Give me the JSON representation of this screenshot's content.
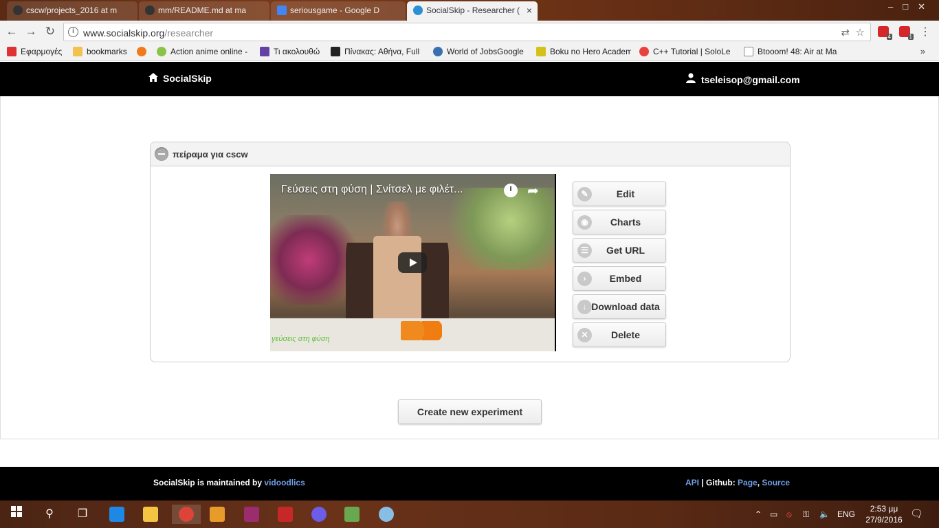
{
  "browser": {
    "tabs": [
      {
        "label": "cscw/projects_2016 at m",
        "icon_color": "#333333",
        "active": false
      },
      {
        "label": "mm/README.md at ma",
        "icon_color": "#333333",
        "active": false
      },
      {
        "label": "seriousgame - Google D",
        "icon_color": "#4285f4",
        "active": false
      },
      {
        "label": "SocialSkip - Researcher (",
        "icon_color": "#2b8fd6",
        "active": true
      }
    ],
    "close_glyph": "×",
    "url_domain": "www.socialskip.org",
    "url_path": "/researcher",
    "extension_badges": [
      "4",
      "1"
    ],
    "bookmarks": [
      {
        "label": "Εφαρμογές",
        "icon": "apps-icon",
        "color": "#d33"
      },
      {
        "label": "bookmarks",
        "icon": "folder-icon",
        "color": "#f2c14e"
      },
      {
        "label": "",
        "icon": "ubuntu-icon",
        "color": "#f07b1d"
      },
      {
        "label": "Action anime online -",
        "icon": "multicolor-icon",
        "color": "#8bc34a"
      },
      {
        "label": "Τι ακολουθώ",
        "icon": "twitch-icon",
        "color": "#6441a5"
      },
      {
        "label": "Πίνακας: Αθήνα, Full",
        "icon": "cat-icon",
        "color": "#222222"
      },
      {
        "label": "World of JobsGoogle",
        "icon": "c-icon",
        "color": "#3a6fb0"
      },
      {
        "label": "Boku no Hero Academ",
        "icon": "u-icon",
        "color": "#d4c21a"
      },
      {
        "label": "C++ Tutorial | SoloLe",
        "icon": "sololearn-icon",
        "color": "#e8423f"
      },
      {
        "label": "Btooom! 48: Air at Ma",
        "icon": "page-icon",
        "color": "#888888"
      }
    ],
    "bookmarks_more": "»"
  },
  "site": {
    "brand": "SocialSkip",
    "user_email": "tseleisop@gmail.com"
  },
  "experiment": {
    "title": "πείραμα για cscw",
    "video_title": "Γεύσεις στη φύση | Σνίτσελ με φιλέτ...",
    "video_watermark": "γεύσεις στη φύση",
    "actions": [
      {
        "label": "Edit",
        "icon": "pencil-icon",
        "glyph": "✎"
      },
      {
        "label": "Charts",
        "icon": "eye-icon",
        "glyph": "◉"
      },
      {
        "label": "Get URL",
        "icon": "list-icon",
        "glyph": "☰"
      },
      {
        "label": "Embed",
        "icon": "chevron-right-icon",
        "glyph": "›"
      },
      {
        "label": "Download data",
        "icon": "download-icon",
        "glyph": "↓"
      },
      {
        "label": "Delete",
        "icon": "close-icon",
        "glyph": "✕"
      }
    ]
  },
  "create_button": "Create new experiment",
  "footer": {
    "maintained_prefix": "SocialSkip is maintained by",
    "maintainer": "vidoodlics",
    "api": "API",
    "sep1": " | Github: ",
    "page": "Page",
    "comma": ", ",
    "source": "Source"
  },
  "taskbar": {
    "lang": "ENG",
    "time": "2:53 μμ",
    "date": "27/9/2016",
    "apps": [
      {
        "name": "edge-icon",
        "color": "#1e88e5"
      },
      {
        "name": "file-explorer-icon",
        "color": "#f4c542"
      },
      {
        "name": "chrome-icon",
        "color": "#db4437"
      },
      {
        "name": "media-player-icon",
        "color": "#e69b2b"
      },
      {
        "name": "flash-icon",
        "color": "#9b2d6e"
      },
      {
        "name": "acrobat-icon",
        "color": "#c62828"
      },
      {
        "name": "cat-app-icon",
        "color": "#6c5ce7"
      },
      {
        "name": "notepad-icon",
        "color": "#6aa84f"
      },
      {
        "name": "paint-icon",
        "color": "#88bde6"
      }
    ]
  }
}
